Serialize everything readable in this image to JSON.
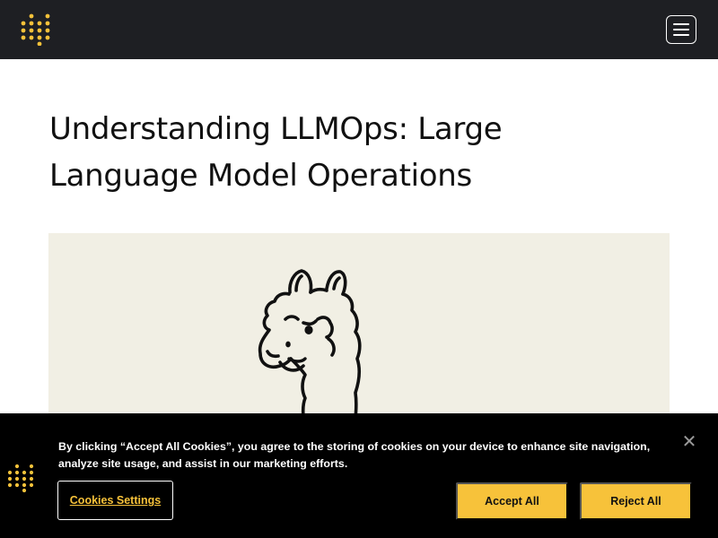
{
  "header": {
    "logo_icon": "dotted-grid-logo",
    "menu_icon": "hamburger-menu-icon",
    "brand_color": "#f7c23a",
    "background": "#1e1f23"
  },
  "article": {
    "title": "Understanding LLMOps: Large Language Model Operations",
    "hero_image": "llama-line-drawing",
    "hero_background": "#f1efe4"
  },
  "cookie_banner": {
    "text": "By clicking “Accept All Cookies”, you agree to the storing of cookies on your device to enhance site navigation, analyze site usage, and assist in our marketing efforts.",
    "settings_label": "Cookies Settings",
    "accept_label": "Accept All",
    "reject_label": "Reject All",
    "close_icon": "close-icon",
    "close_glyph": "✕"
  }
}
